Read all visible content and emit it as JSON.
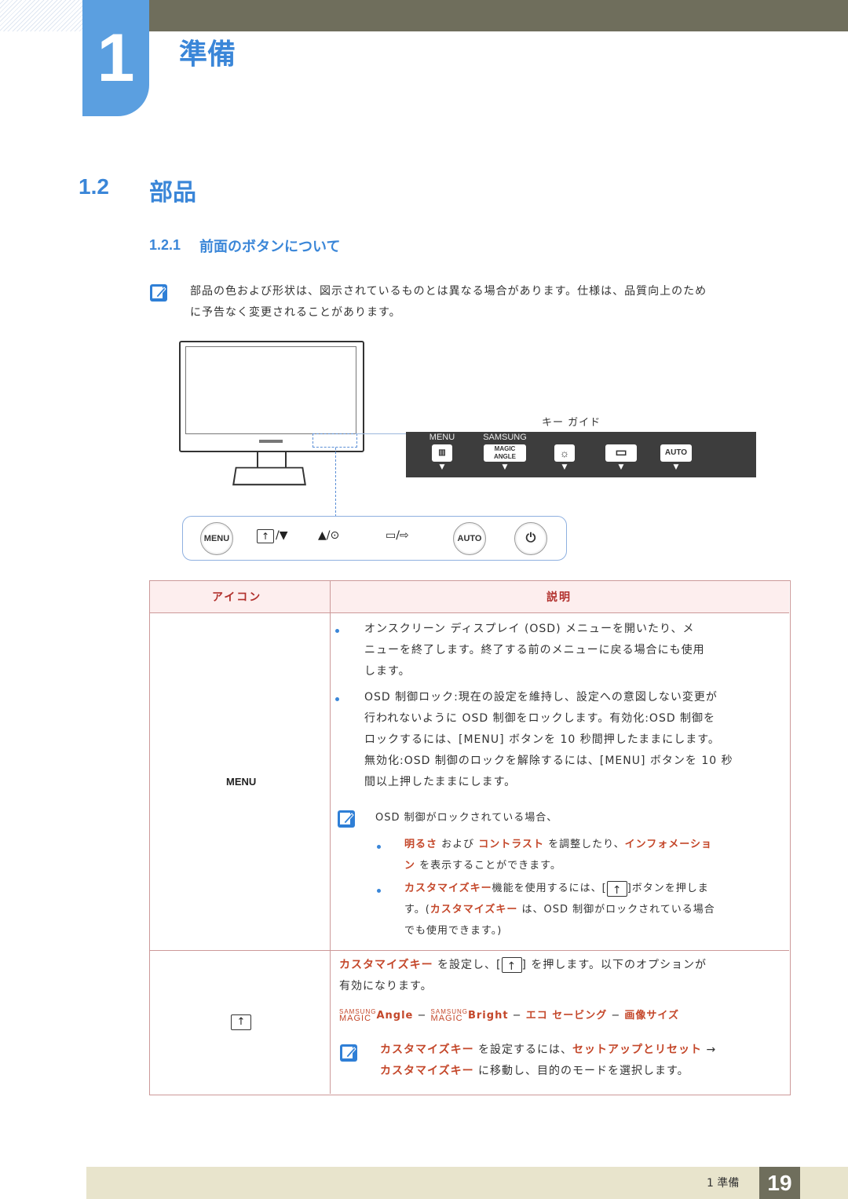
{
  "header": {
    "chapter_number": "1",
    "chapter_title": "準備"
  },
  "section": {
    "number": "1.2",
    "title": "部品"
  },
  "subsection": {
    "number": "1.2.1",
    "title": "前面のボタンについて"
  },
  "note": {
    "icon": "note-pencil-icon",
    "line1": "部品の色および形状は、図示されているものとは異なる場合があります。仕様は、品質向上のため",
    "line2": "に予告なく変更されることがあります。"
  },
  "key_guide": {
    "label": "キー ガイド",
    "items": [
      {
        "caption": "MENU",
        "key": "",
        "icon": "menu-icon"
      },
      {
        "caption": "SAMSUNG",
        "key": "MAGIC ANGLE",
        "icon": "magic-angle-icon"
      },
      {
        "caption": "",
        "key": "☼",
        "icon": "brightness-icon"
      },
      {
        "caption": "",
        "key": "▭",
        "icon": "source-icon"
      },
      {
        "caption": "",
        "key": "AUTO",
        "icon": "auto-icon"
      }
    ]
  },
  "front_buttons": {
    "menu": "MENU",
    "customize_label": "/▼",
    "brightness_label": "▲/⊙",
    "source_label": "▭/⇨",
    "auto": "AUTO",
    "power_icon": "power-icon"
  },
  "table": {
    "col_icon": "アイコン",
    "col_desc": "説明",
    "row1": {
      "icon_label": "MENU",
      "bullet1": [
        "オンスクリーン ディスプレイ (OSD) メニューを開いたり、メ",
        "ニューを終了します。終了する前のメニューに戻る場合にも使用",
        "します。"
      ],
      "bullet2": [
        "OSD 制御ロック:現在の設定を維持し、設定への意図しない変更が",
        "行われないように OSD 制御をロックします。有効化:OSD 制御を",
        "ロックするには、[MENU] ボタンを 10 秒間押したままにします。",
        "無効化:OSD 制御のロックを解除するには、[MENU] ボタンを 10 秒",
        "間以上押したままにします。"
      ],
      "note_title": "OSD 制御がロックされている場合、",
      "sub1_red1": "明るさ",
      "sub1_mid1": " および ",
      "sub1_red2": "コントラスト",
      "sub1_mid2": " を調整したり、",
      "sub1_red3": "インフォメーショ",
      "sub1_red4": "ン",
      "sub1_end": " を表示することができます。",
      "sub2_red1": "カスタマイズキー",
      "sub2_mid1": "機能を使用するには、[",
      "sub2_mid2": "]ボタンを押しま",
      "sub2_line2a": "す。(",
      "sub2_red2": "カスタマイズキー",
      "sub2_line2b": " は、OSD 制御がロックされている場合",
      "sub2_line3": "でも使用できます。)"
    },
    "row2": {
      "red1": "カスタマイズキー",
      "mid1": " を設定し、[",
      "mid2": "] を押します。以下のオプションが",
      "line2": "有効になります。",
      "opt_samsung1": "SAMSUNG",
      "opt_magic1": "MAGIC",
      "opt_angle": "Angle",
      "opt_sep1": " − ",
      "opt_samsung2": "SAMSUNG",
      "opt_magic2": "MAGIC",
      "opt_bright": "Bright",
      "opt_sep2": " − ",
      "opt_eco": "エコ セービング",
      "opt_sep3": " − ",
      "opt_size": "画像サイズ",
      "note_red1": "カスタマイズキー",
      "note_mid1": " を設定するには、",
      "note_red2": "セットアップとリセット",
      "note_arrow": " →",
      "note_red3": "カスタマイズキー",
      "note_end": " に移動し、目的のモードを選択します。"
    }
  },
  "footer": {
    "label": "1 準備",
    "page": "19"
  }
}
